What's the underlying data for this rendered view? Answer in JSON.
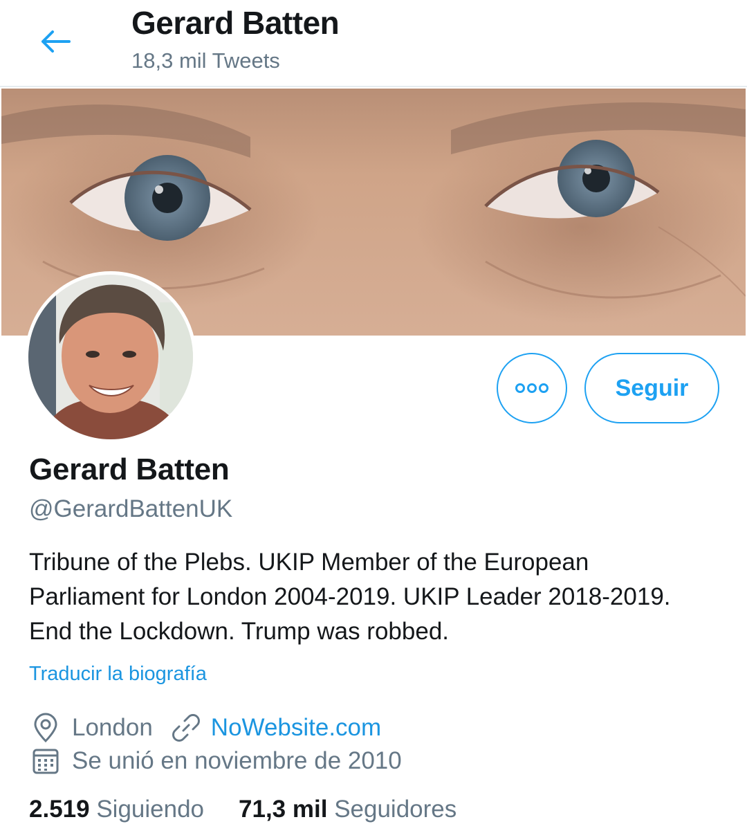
{
  "header": {
    "title": "Gerard Batten",
    "subtitle": "18,3 mil Tweets"
  },
  "profile": {
    "name": "Gerard Batten",
    "handle": "@GerardBattenUK",
    "bio": "Tribune of the Plebs. UKIP Member of the European Parliament for London 2004-2019. UKIP Leader 2018-2019. End the Lockdown. Trump was robbed.",
    "translate_label": "Traducir la biografía",
    "location": "London",
    "website": "NoWebsite.com",
    "joined": "Se unió en noviembre de 2010"
  },
  "actions": {
    "follow_label": "Seguir"
  },
  "stats": {
    "following_count": "2.519",
    "following_label": "Siguiendo",
    "followers_count": "71,3 mil",
    "followers_label": "Seguidores"
  },
  "colors": {
    "accent": "#1da1f2",
    "link": "#1b95e0",
    "muted": "#657786",
    "text": "#14171a"
  },
  "icons": [
    "back-arrow-icon",
    "more-options-icon",
    "location-pin-icon",
    "link-icon",
    "calendar-icon"
  ]
}
